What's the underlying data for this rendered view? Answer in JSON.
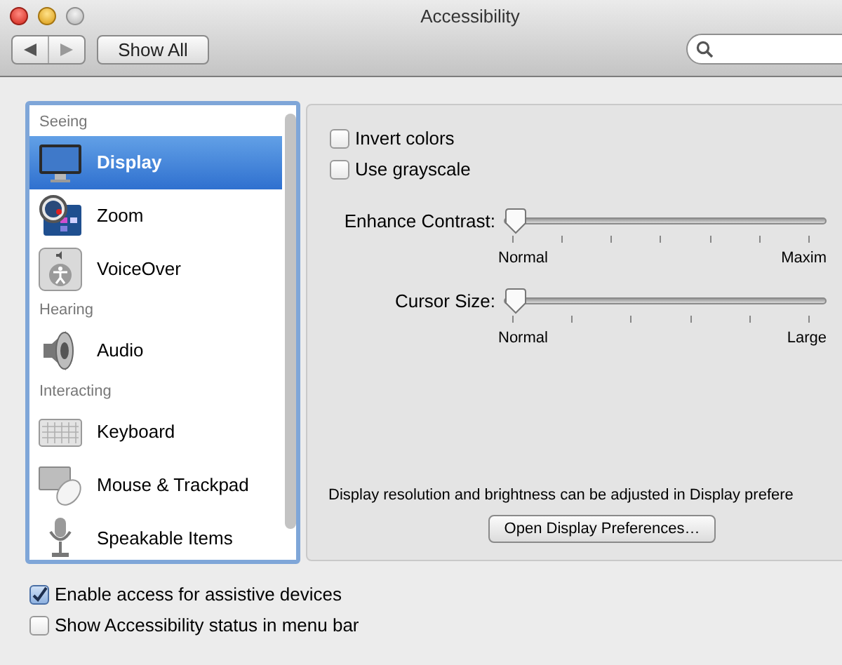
{
  "window": {
    "title": "Accessibility"
  },
  "toolbar": {
    "show_all": "Show All"
  },
  "sidebar": {
    "items": [
      {
        "kind": "header",
        "label": "Seeing",
        "selected": false
      },
      {
        "kind": "item",
        "label": "Display",
        "selected": true
      },
      {
        "kind": "item",
        "label": "Zoom",
        "selected": false
      },
      {
        "kind": "item",
        "label": "VoiceOver",
        "selected": false
      },
      {
        "kind": "header",
        "label": "Hearing",
        "selected": false
      },
      {
        "kind": "item",
        "label": "Audio",
        "selected": false
      },
      {
        "kind": "header",
        "label": "Interacting",
        "selected": false
      },
      {
        "kind": "item",
        "label": "Keyboard",
        "selected": false
      },
      {
        "kind": "item",
        "label": "Mouse & Trackpad",
        "selected": false
      },
      {
        "kind": "item",
        "label": "Speakable Items",
        "selected": false
      }
    ]
  },
  "panel": {
    "checkboxes": [
      {
        "label": "Invert colors",
        "checked": false
      },
      {
        "label": "Use grayscale",
        "checked": false
      }
    ],
    "sliders": [
      {
        "label": "Enhance Contrast:",
        "level": 0,
        "min_label": "Normal",
        "max_label": "Maxim"
      },
      {
        "label": "Cursor Size:",
        "level": 0,
        "min_label": "Normal",
        "max_label": "Large"
      }
    ],
    "note": "Display resolution and brightness can be adjusted in Display prefere",
    "button": "Open Display Preferences…"
  },
  "footer": {
    "checkboxes": [
      {
        "label": "Enable access for assistive devices",
        "checked": true
      },
      {
        "label": "Show Accessibility status in menu bar",
        "checked": false
      }
    ]
  }
}
